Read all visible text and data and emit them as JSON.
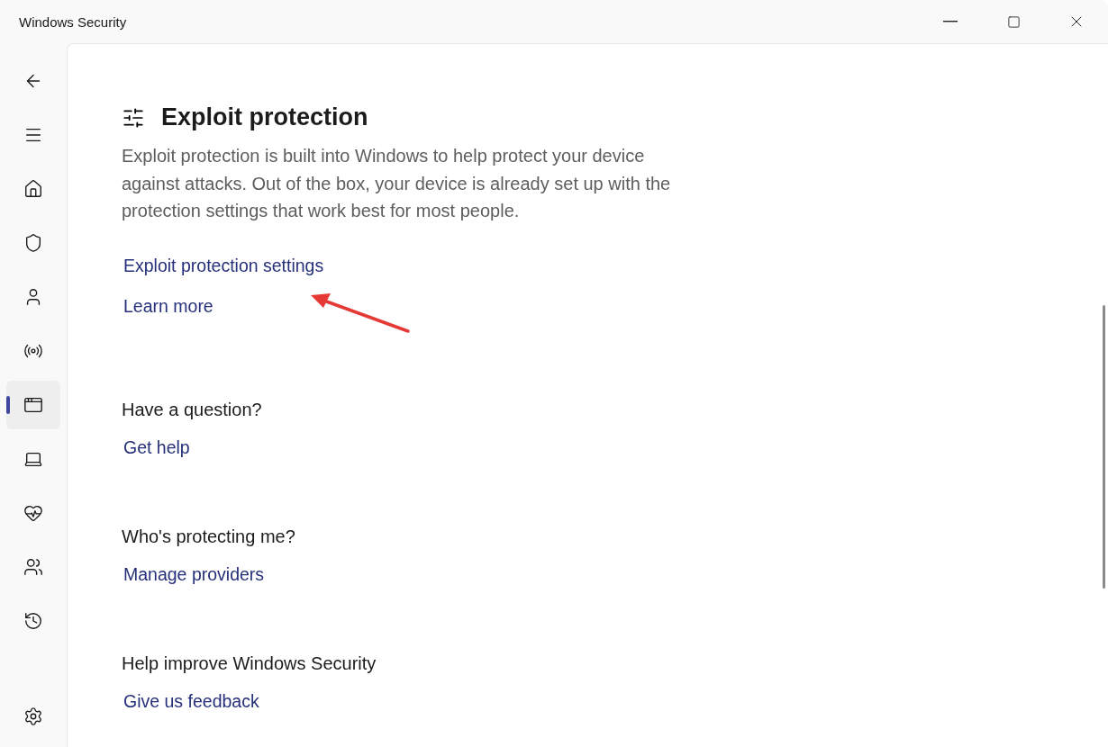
{
  "window": {
    "title": "Windows Security"
  },
  "nav": {
    "items": [
      {
        "kind": "back",
        "selected": false
      },
      {
        "kind": "menu",
        "selected": false
      },
      {
        "kind": "home",
        "selected": false
      },
      {
        "kind": "shield",
        "selected": false
      },
      {
        "kind": "person",
        "selected": false
      },
      {
        "kind": "wireless",
        "selected": false
      },
      {
        "kind": "app",
        "selected": true
      },
      {
        "kind": "laptop",
        "selected": false
      },
      {
        "kind": "heart",
        "selected": false
      },
      {
        "kind": "family",
        "selected": false
      },
      {
        "kind": "history",
        "selected": false
      }
    ],
    "settings": {
      "kind": "settings",
      "selected": false
    }
  },
  "page": {
    "title": "Exploit protection",
    "description": "Exploit protection is built into Windows to help protect your device against attacks.  Out of the box, your device is already set up with the protection settings that work best for most people.",
    "links": [
      "Exploit protection settings",
      "Learn more"
    ]
  },
  "sections": [
    {
      "heading": "Have a question?",
      "link": "Get help"
    },
    {
      "heading": "Who's protecting me?",
      "link": "Manage providers"
    },
    {
      "heading": "Help improve Windows Security",
      "link": "Give us feedback"
    }
  ]
}
